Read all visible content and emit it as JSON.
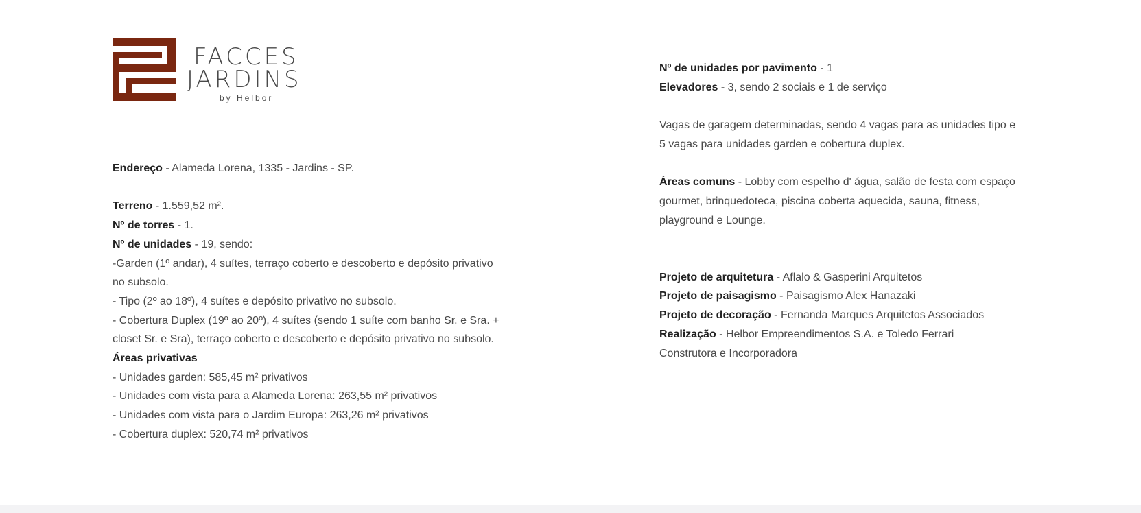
{
  "brand": {
    "name_line1": "FACCES",
    "name_line2": "JARDINS",
    "byline": "by Helbor",
    "colors": {
      "mark": "#7a2710",
      "text": "#4a4a4a",
      "footer": "#f3f3f5"
    }
  },
  "left": {
    "endereco": {
      "label": "Endereço",
      "value": " - Alameda Lorena, 1335 - Jardins - SP."
    },
    "terreno": {
      "label": "Terreno",
      "value": " - 1.559,52 m²."
    },
    "torres": {
      "label": "Nº de torres",
      "value": " - 1."
    },
    "unidades": {
      "label": "Nº de unidades",
      "value": " - 19, sendo:"
    },
    "unidades_lines": [
      "-Garden (1º andar), 4 suítes, terraço coberto e descoberto e depósito privativo",
      "no subsolo.",
      "- Tipo (2º ao 18º), 4 suítes e depósito privativo no subsolo.",
      "- Cobertura Duplex (19º ao 20º), 4 suítes (sendo 1 suíte com banho Sr. e Sra. +",
      "closet Sr. e Sra), terraço coberto e descoberto e depósito privativo no subsolo."
    ],
    "areas_privativas_title": "Áreas privativas",
    "areas_privativas": [
      "- Unidades garden: 585,45 m² privativos",
      "- Unidades com vista para a Alameda Lorena: 263,55 m² privativos",
      "- Unidades com vista para o Jardim Europa: 263,26 m² privativos",
      "- Cobertura duplex: 520,74 m² privativos"
    ]
  },
  "right": {
    "unidades_pavimento": {
      "label": "Nº de unidades por pavimento",
      "value": " - 1"
    },
    "elevadores": {
      "label": "Elevadores",
      "value": " - 3, sendo 2 sociais e 1 de serviço"
    },
    "vagas_lines": [
      "Vagas de garagem determinadas, sendo 4 vagas para as unidades tipo e",
      "5 vagas para unidades garden e cobertura duplex."
    ],
    "areas_comuns": {
      "label": "Áreas comuns",
      "lines": [
        " - Lobby com espelho d' água, salão de festa com espaço",
        "gourmet, brinquedoteca, piscina coberta aquecida, sauna, fitness,",
        "playground e Lounge."
      ]
    },
    "arquitetura": {
      "label": "Projeto de arquitetura",
      "value": " - Aflalo & Gasperini Arquitetos"
    },
    "paisagismo": {
      "label": "Projeto de paisagismo",
      "value": " - Paisagismo Alex Hanazaki"
    },
    "decoracao": {
      "label": "Projeto de decoração",
      "value": " - Fernanda Marques Arquitetos Associados"
    },
    "realizacao": {
      "label": "Realização",
      "value": " - Helbor Empreendimentos S.A. e Toledo Ferrari",
      "line2": "Construtora e Incorporadora"
    }
  }
}
